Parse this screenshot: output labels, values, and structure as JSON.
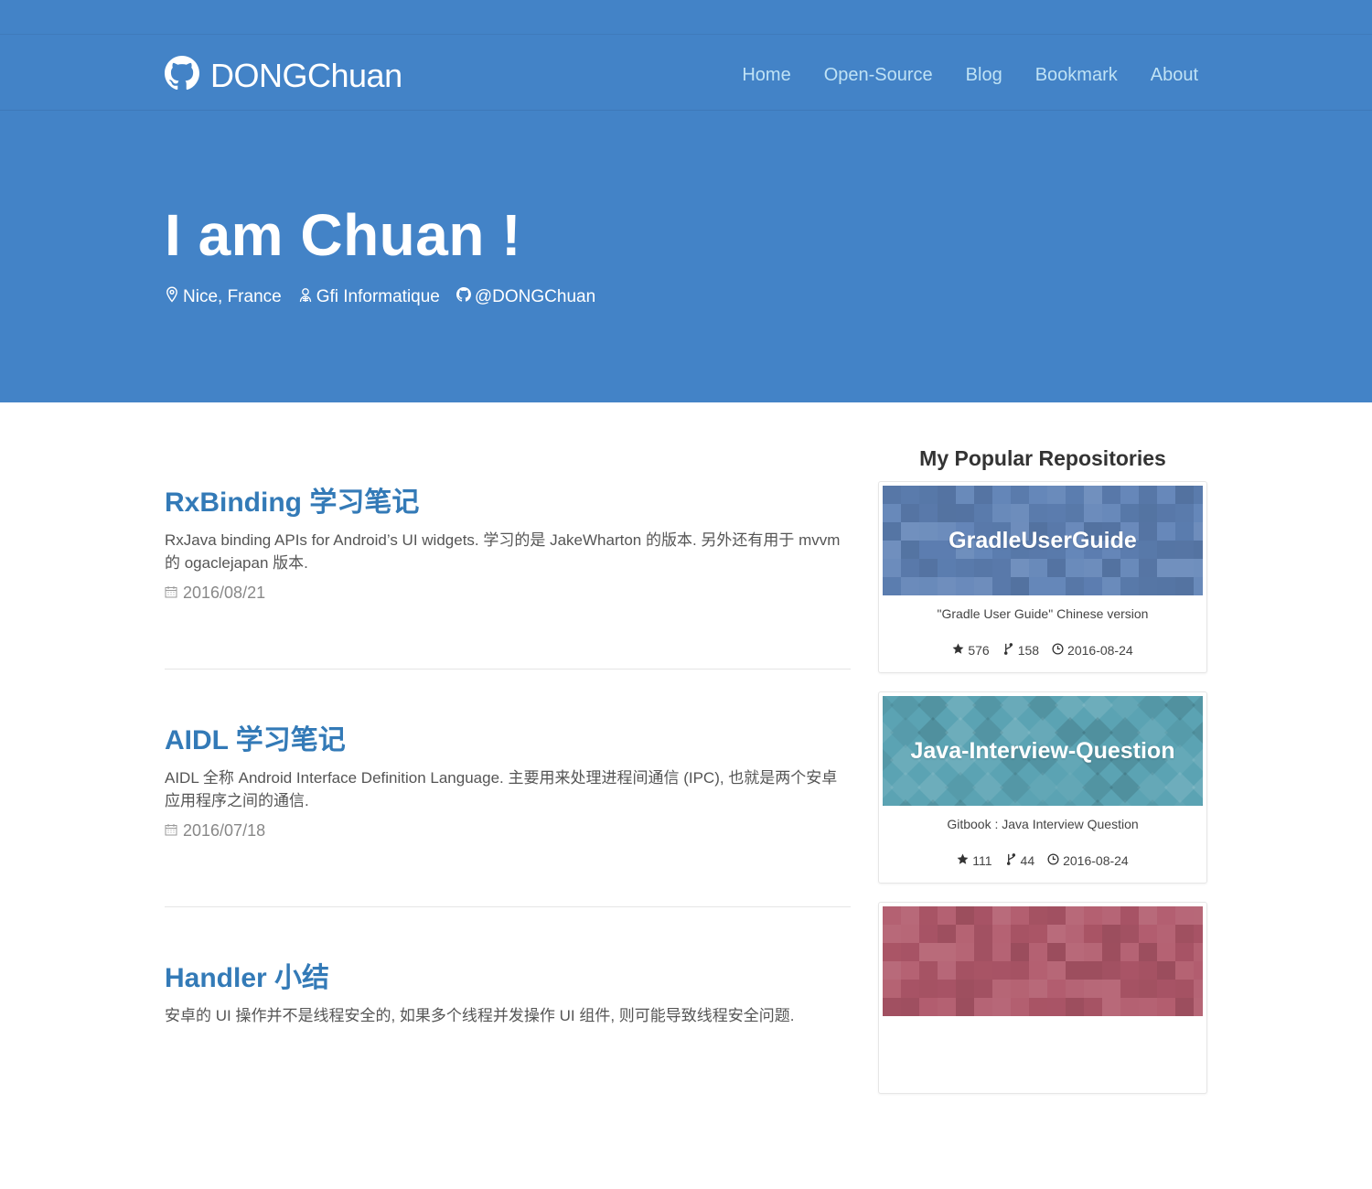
{
  "brand": {
    "name": "DONGChuan",
    "icon": "github-icon"
  },
  "nav": {
    "items": [
      {
        "label": "Home"
      },
      {
        "label": "Open-Source"
      },
      {
        "label": "Blog"
      },
      {
        "label": "Bookmark"
      },
      {
        "label": "About"
      }
    ]
  },
  "hero": {
    "title": "I am Chuan !",
    "location": "Nice, France",
    "company": "Gfi Informatique",
    "github": "@DONGChuan"
  },
  "posts": [
    {
      "title": "RxBinding 学习笔记",
      "excerpt": "RxJava binding APIs for Android’s UI widgets. 学习的是 JakeWharton 的版本. 另外还有用于 mvvm 的 ogaclejapan 版本.",
      "date": "2016/08/21"
    },
    {
      "title": "AIDL 学习笔记",
      "excerpt": "AIDL 全称 Android Interface Definition Language. 主要用来处理进程间通信 (IPC), 也就是两个安卓应用程序之间的通信.",
      "date": "2016/07/18"
    },
    {
      "title": "Handler 小结",
      "excerpt": "安卓的 UI 操作并不是线程安全的, 如果多个线程并发操作 UI 组件, 则可能导致线程安全问题.",
      "date": ""
    }
  ],
  "sidebar": {
    "title": "My Popular Repositories",
    "repos": [
      {
        "name": "GradleUserGuide",
        "description": "\"Gradle User Guide\" Chinese version",
        "stars": "576",
        "forks": "158",
        "updated": "2016-08-24",
        "color": "#5f82b6"
      },
      {
        "name": "Java-Interview-Question",
        "description": "Gitbook : Java Interview Question",
        "stars": "111",
        "forks": "44",
        "updated": "2016-08-24",
        "color": "#5ba3b3"
      },
      {
        "name": "",
        "description": "",
        "stars": "",
        "forks": "",
        "updated": "",
        "color": "#b0586a"
      }
    ]
  },
  "colors": {
    "header": "#4383c7",
    "link": "#337ab7",
    "nav": "#bfe2f5"
  }
}
